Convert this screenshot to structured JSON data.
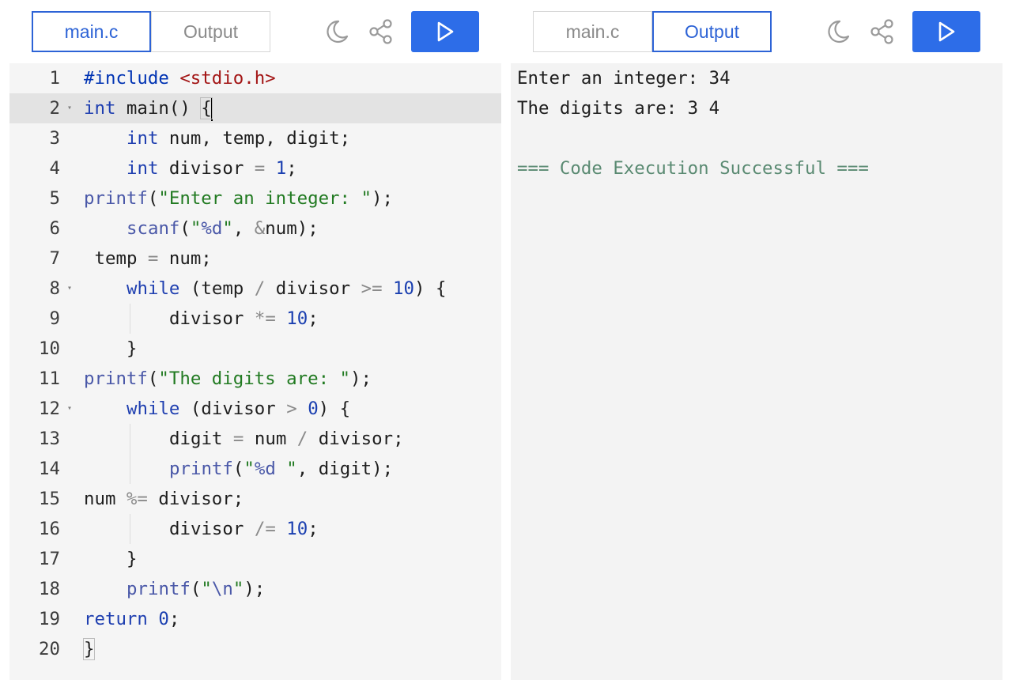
{
  "editor_pane": {
    "tabs": [
      {
        "label": "main.c",
        "active": true
      },
      {
        "label": "Output",
        "active": false
      }
    ],
    "icons": {
      "theme": "moon-icon",
      "share": "share-icon",
      "run": "play-icon"
    },
    "active_line": 2,
    "code_lines": [
      {
        "n": "1",
        "fold": "",
        "indent": 0,
        "guides": [],
        "tokens": [
          [
            "#include ",
            "#0033b3"
          ],
          [
            "<stdio.h>",
            "#a31515"
          ]
        ]
      },
      {
        "n": "2",
        "fold": "▾",
        "indent": 0,
        "guides": [],
        "tokens": [
          [
            "int",
            "#1f3fb0"
          ],
          [
            " main() ",
            "#1e1e1e"
          ],
          [
            "{",
            "#1e1e1e",
            "bracket"
          ]
        ]
      },
      {
        "n": "3",
        "fold": "",
        "indent": 4,
        "guides": [],
        "tokens": [
          [
            "int",
            "#1f3fb0"
          ],
          [
            " num, temp, digit;",
            "#1e1e1e"
          ]
        ]
      },
      {
        "n": "4",
        "fold": "",
        "indent": 4,
        "guides": [],
        "tokens": [
          [
            "int",
            "#1f3fb0"
          ],
          [
            " divisor ",
            "#1e1e1e"
          ],
          [
            "=",
            "#8a8a8a"
          ],
          [
            " ",
            "#1e1e1e"
          ],
          [
            "1",
            "#1a3fb0"
          ],
          [
            ";",
            "#1e1e1e"
          ]
        ]
      },
      {
        "n": "5",
        "fold": "",
        "indent": 0,
        "guides": [],
        "tokens": [
          [
            "printf",
            "#4a58a8"
          ],
          [
            "(",
            "#1e1e1e"
          ],
          [
            "\"Enter an integer: \"",
            "#217a21"
          ],
          [
            ");",
            "#1e1e1e"
          ]
        ]
      },
      {
        "n": "6",
        "fold": "",
        "indent": 4,
        "guides": [],
        "tokens": [
          [
            "scanf",
            "#4a58a8"
          ],
          [
            "(",
            "#1e1e1e"
          ],
          [
            "\"",
            "#217a21"
          ],
          [
            "%d",
            "#4a58a8"
          ],
          [
            "\"",
            "#217a21"
          ],
          [
            ", ",
            "#1e1e1e"
          ],
          [
            "&",
            "#8a8a8a"
          ],
          [
            "num);",
            "#1e1e1e"
          ]
        ]
      },
      {
        "n": "7",
        "fold": "",
        "indent": 1,
        "guides": [],
        "tokens": [
          [
            "temp ",
            "#1e1e1e"
          ],
          [
            "=",
            "#8a8a8a"
          ],
          [
            " num;",
            "#1e1e1e"
          ]
        ]
      },
      {
        "n": "8",
        "fold": "▾",
        "indent": 4,
        "guides": [],
        "tokens": [
          [
            "while",
            "#1f3fb0"
          ],
          [
            " (temp ",
            "#1e1e1e"
          ],
          [
            "/",
            "#8a8a8a"
          ],
          [
            " divisor ",
            "#1e1e1e"
          ],
          [
            ">=",
            "#8a8a8a"
          ],
          [
            " ",
            "#1e1e1e"
          ],
          [
            "10",
            "#1a3fb0"
          ],
          [
            ") {",
            "#1e1e1e"
          ]
        ]
      },
      {
        "n": "9",
        "fold": "",
        "indent": 8,
        "guides": [
          4
        ],
        "tokens": [
          [
            "divisor ",
            "#1e1e1e"
          ],
          [
            "*=",
            "#8a8a8a"
          ],
          [
            " ",
            "#1e1e1e"
          ],
          [
            "10",
            "#1a3fb0"
          ],
          [
            ";",
            "#1e1e1e"
          ]
        ]
      },
      {
        "n": "10",
        "fold": "",
        "indent": 4,
        "guides": [],
        "tokens": [
          [
            "}",
            "#1e1e1e"
          ]
        ]
      },
      {
        "n": "11",
        "fold": "",
        "indent": 0,
        "guides": [],
        "tokens": [
          [
            "printf",
            "#4a58a8"
          ],
          [
            "(",
            "#1e1e1e"
          ],
          [
            "\"The digits are: \"",
            "#217a21"
          ],
          [
            ");",
            "#1e1e1e"
          ]
        ]
      },
      {
        "n": "12",
        "fold": "▾",
        "indent": 4,
        "guides": [],
        "tokens": [
          [
            "while",
            "#1f3fb0"
          ],
          [
            " (divisor ",
            "#1e1e1e"
          ],
          [
            ">",
            "#8a8a8a"
          ],
          [
            " ",
            "#1e1e1e"
          ],
          [
            "0",
            "#1a3fb0"
          ],
          [
            ") {",
            "#1e1e1e"
          ]
        ]
      },
      {
        "n": "13",
        "fold": "",
        "indent": 8,
        "guides": [
          4
        ],
        "tokens": [
          [
            "digit ",
            "#1e1e1e"
          ],
          [
            "=",
            "#8a8a8a"
          ],
          [
            " num ",
            "#1e1e1e"
          ],
          [
            "/",
            "#8a8a8a"
          ],
          [
            " divisor;",
            "#1e1e1e"
          ]
        ]
      },
      {
        "n": "14",
        "fold": "",
        "indent": 8,
        "guides": [
          4
        ],
        "tokens": [
          [
            "printf",
            "#4a58a8"
          ],
          [
            "(",
            "#1e1e1e"
          ],
          [
            "\"",
            "#217a21"
          ],
          [
            "%d",
            "#4a58a8"
          ],
          [
            " \"",
            "#217a21"
          ],
          [
            ", digit);",
            "#1e1e1e"
          ]
        ]
      },
      {
        "n": "15",
        "fold": "",
        "indent": 0,
        "guides": [],
        "tokens": [
          [
            "num ",
            "#1e1e1e"
          ],
          [
            "%=",
            "#8a8a8a"
          ],
          [
            " divisor;",
            "#1e1e1e"
          ]
        ]
      },
      {
        "n": "16",
        "fold": "",
        "indent": 8,
        "guides": [
          4
        ],
        "tokens": [
          [
            "divisor ",
            "#1e1e1e"
          ],
          [
            "/=",
            "#8a8a8a"
          ],
          [
            " ",
            "#1e1e1e"
          ],
          [
            "10",
            "#1a3fb0"
          ],
          [
            ";",
            "#1e1e1e"
          ]
        ]
      },
      {
        "n": "17",
        "fold": "",
        "indent": 4,
        "guides": [],
        "tokens": [
          [
            "}",
            "#1e1e1e"
          ]
        ]
      },
      {
        "n": "18",
        "fold": "",
        "indent": 4,
        "guides": [],
        "tokens": [
          [
            "printf",
            "#4a58a8"
          ],
          [
            "(",
            "#1e1e1e"
          ],
          [
            "\"",
            "#217a21"
          ],
          [
            "\\n",
            "#4a58a8"
          ],
          [
            "\"",
            "#217a21"
          ],
          [
            ");",
            "#1e1e1e"
          ]
        ]
      },
      {
        "n": "19",
        "fold": "",
        "indent": 0,
        "guides": [],
        "tokens": [
          [
            "return",
            "#1f3fb0"
          ],
          [
            " ",
            "#1e1e1e"
          ],
          [
            "0",
            "#1a3fb0"
          ],
          [
            ";",
            "#1e1e1e"
          ]
        ]
      },
      {
        "n": "20",
        "fold": "",
        "indent": 0,
        "guides": [],
        "tokens": [
          [
            "}",
            "#1e1e1e",
            "bracket"
          ]
        ]
      }
    ]
  },
  "output_pane": {
    "tabs": [
      {
        "label": "main.c",
        "active": false
      },
      {
        "label": "Output",
        "active": true
      }
    ],
    "icons": {
      "theme": "moon-icon",
      "share": "share-icon",
      "run": "play-icon"
    },
    "lines": [
      {
        "text": "Enter an integer: 34",
        "kind": "stdout"
      },
      {
        "text": "The digits are: 3 4",
        "kind": "stdout"
      },
      {
        "text": "",
        "kind": "blank"
      },
      {
        "text": "=== Code Execution Successful ===",
        "kind": "success"
      }
    ]
  },
  "colors": {
    "accent": "#2d63d6",
    "run_button": "#2d6de8",
    "editor_bg": "#f5f5f5",
    "output_bg": "#f3f3f3",
    "success": "#5a8a72"
  }
}
